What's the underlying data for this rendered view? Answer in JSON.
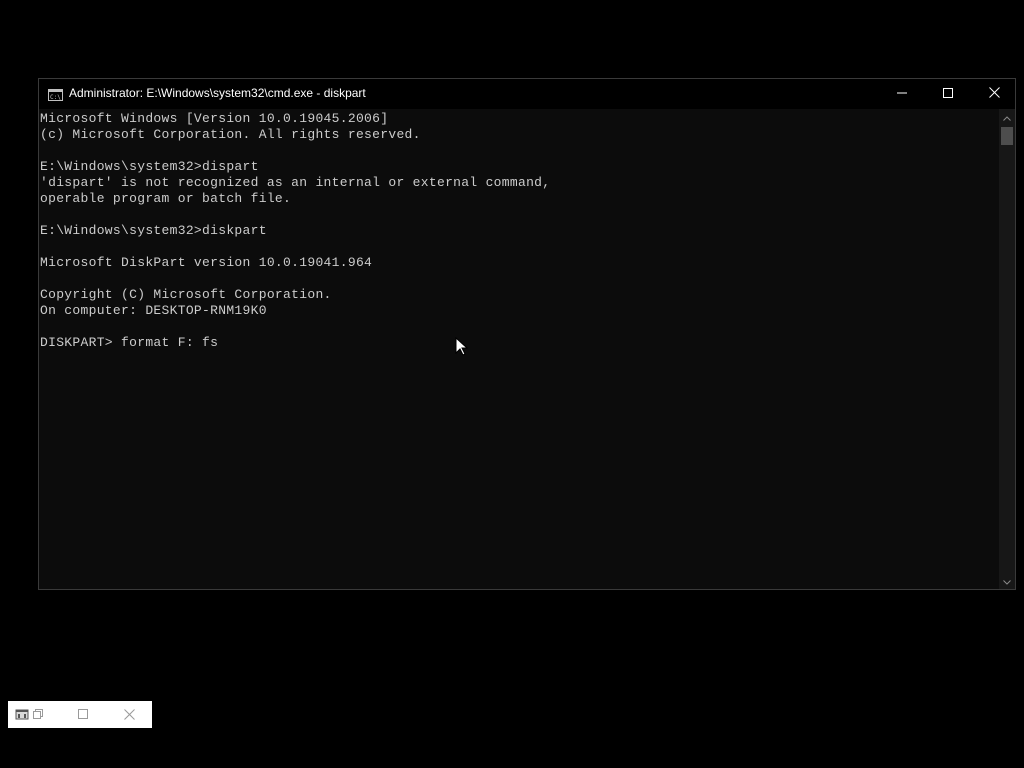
{
  "window": {
    "title": "Administrator: E:\\Windows\\system32\\cmd.exe - diskpart",
    "icons": {
      "app": "cmd-icon",
      "minimize": "minimize-icon",
      "maximize": "maximize-icon",
      "close": "close-icon"
    }
  },
  "console": {
    "lines": [
      "Microsoft Windows [Version 10.0.19045.2006]",
      "(c) Microsoft Corporation. All rights reserved.",
      "",
      "E:\\Windows\\system32>dispart",
      "'dispart' is not recognized as an internal or external command,",
      "operable program or batch file.",
      "",
      "E:\\Windows\\system32>diskpart",
      "",
      "Microsoft DiskPart version 10.0.19041.964",
      "",
      "Copyright (C) Microsoft Corporation.",
      "On computer: DESKTOP-RNM19K0",
      "",
      "DISKPART> format F: fs"
    ],
    "text_color": "#cccccc",
    "background": "#0c0c0c"
  },
  "scrollbar": {
    "up_icon": "chevron-up-icon",
    "down_icon": "chevron-down-icon"
  },
  "minimized_window": {
    "icons": [
      "app-icon",
      "restore-icon",
      "maximize-icon",
      "close-icon"
    ]
  }
}
